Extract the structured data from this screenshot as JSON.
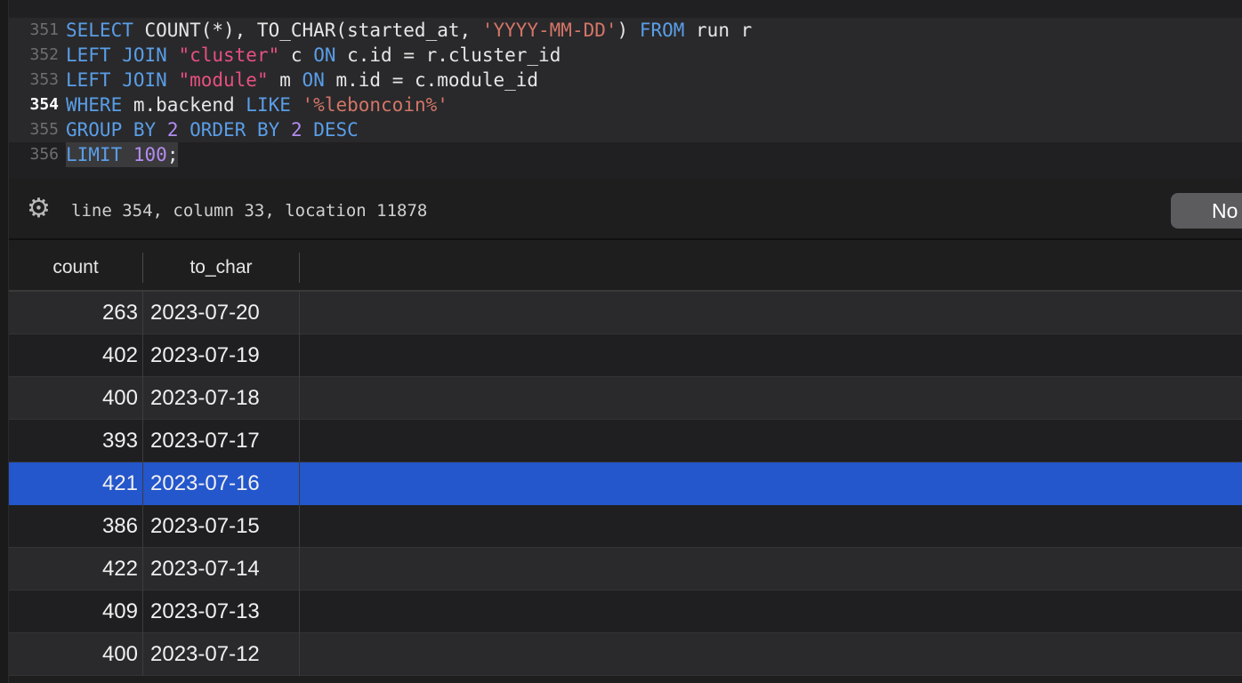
{
  "editor": {
    "top_partial_line": "350",
    "bottom_partial_line": "357",
    "current_line": "354",
    "lines": [
      {
        "num": "351",
        "tokens": [
          [
            "kw",
            "SELECT"
          ],
          [
            "t",
            " COUNT(*), TO_CHAR(started_at, "
          ],
          [
            "lit",
            "'YYYY-MM-DD'"
          ],
          [
            "t",
            ") "
          ],
          [
            "kw",
            "FROM"
          ],
          [
            "t",
            " run r"
          ]
        ]
      },
      {
        "num": "352",
        "tokens": [
          [
            "kw",
            "LEFT JOIN"
          ],
          [
            "t",
            " "
          ],
          [
            "str",
            "\"cluster\""
          ],
          [
            "t",
            " c "
          ],
          [
            "kw",
            "ON"
          ],
          [
            "t",
            " c.id = r.cluster_id"
          ]
        ]
      },
      {
        "num": "353",
        "tokens": [
          [
            "kw",
            "LEFT JOIN"
          ],
          [
            "t",
            " "
          ],
          [
            "str",
            "\"module\""
          ],
          [
            "t",
            " m "
          ],
          [
            "kw",
            "ON"
          ],
          [
            "t",
            " m.id = c.module_id"
          ]
        ]
      },
      {
        "num": "354",
        "tokens": [
          [
            "kw",
            "WHERE"
          ],
          [
            "t",
            " m.backend "
          ],
          [
            "kw",
            "LIKE"
          ],
          [
            "t",
            " "
          ],
          [
            "lit",
            "'%leboncoin%'"
          ]
        ]
      },
      {
        "num": "355",
        "tokens": [
          [
            "kw",
            "GROUP BY"
          ],
          [
            "t",
            " "
          ],
          [
            "num",
            "2"
          ],
          [
            "t",
            " "
          ],
          [
            "kw",
            "ORDER BY"
          ],
          [
            "t",
            " "
          ],
          [
            "num",
            "2"
          ],
          [
            "t",
            " "
          ],
          [
            "kw",
            "DESC"
          ]
        ]
      },
      {
        "num": "356",
        "tokens": [
          [
            "kw",
            "LIMIT"
          ],
          [
            "t",
            " "
          ],
          [
            "num",
            "100"
          ],
          [
            "t",
            ";"
          ]
        ]
      }
    ]
  },
  "status": {
    "icon": "gear-icon",
    "text": "line 354, column 33, location 11878",
    "button_label": "No"
  },
  "results": {
    "columns": [
      "count",
      "to_char"
    ],
    "selected_index": 4,
    "rows": [
      {
        "count": "263",
        "to_char": "2023-07-20"
      },
      {
        "count": "402",
        "to_char": "2023-07-19"
      },
      {
        "count": "400",
        "to_char": "2023-07-18"
      },
      {
        "count": "393",
        "to_char": "2023-07-17"
      },
      {
        "count": "421",
        "to_char": "2023-07-16"
      },
      {
        "count": "386",
        "to_char": "2023-07-15"
      },
      {
        "count": "422",
        "to_char": "2023-07-14"
      },
      {
        "count": "409",
        "to_char": "2023-07-13"
      },
      {
        "count": "400",
        "to_char": "2023-07-12"
      }
    ]
  },
  "colors": {
    "keyword": "#5a9ee8",
    "string": "#e7507f",
    "literal": "#d47567",
    "number": "#b38cf0",
    "selection": "#2456cc"
  }
}
